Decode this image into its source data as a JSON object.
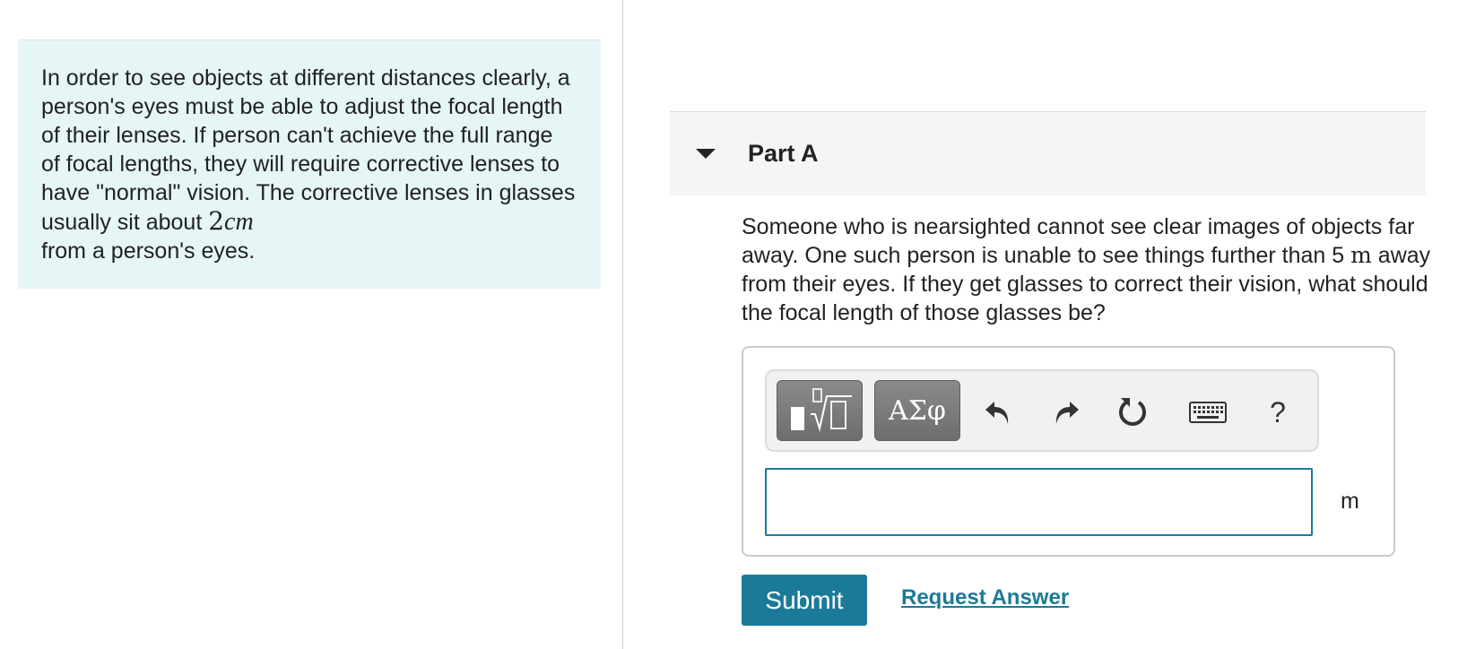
{
  "intro": {
    "text_before": "In order to see objects at different distances clearly, a person's eyes must be able to adjust the focal length of their lenses.  If person can't achieve the full range of focal lengths, they will require corrective lenses to have \"normal\" vision.  The corrective lenses in glasses usually sit about ",
    "math_value": "2",
    "math_unit": "cm",
    "text_after": " from a person's eyes."
  },
  "part": {
    "title": "Part A",
    "question_before": "Someone who is nearsighted cannot see clear images of objects far away.  One such person is unable to see things further than 5 ",
    "question_unit": "m",
    "question_after": " away from their eyes.  If they get glasses to correct their vision, what should the focal length of those glasses be?"
  },
  "toolbar": {
    "symbols_label": "ΑΣφ",
    "help_label": "?",
    "icons": [
      "templates-icon",
      "symbols-icon",
      "undo-icon",
      "redo-icon",
      "reset-icon",
      "keyboard-icon",
      "help-icon"
    ]
  },
  "answer": {
    "value": "",
    "placeholder": "",
    "unit": "m"
  },
  "actions": {
    "submit_label": "Submit",
    "request_answer_label": "Request Answer"
  },
  "colors": {
    "accent": "#1c7a99",
    "intro_background": "#e6f5f5",
    "part_header_background": "#f5f5f5"
  }
}
